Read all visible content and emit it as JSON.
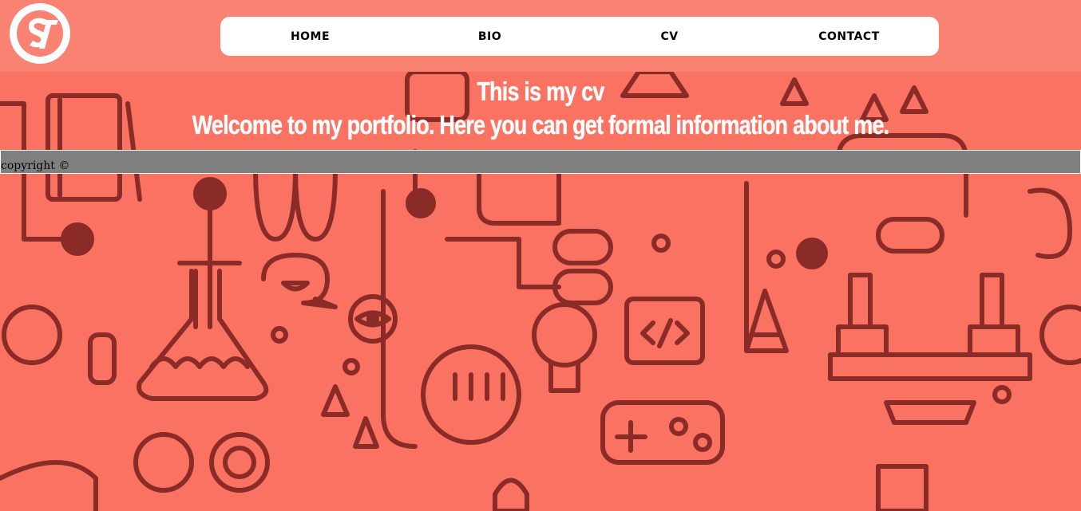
{
  "logo": {
    "text": "ST"
  },
  "nav": {
    "items": [
      "HOME",
      "BIO",
      "CV",
      "CONTACT"
    ]
  },
  "hero": {
    "title": "This is my cv",
    "subtitle": "Welcome to my portfolio. Here you can get formal information about me."
  },
  "footer": {
    "copyright": "copyright ©"
  },
  "colors": {
    "background": "#fa7262",
    "header": "#fa8272",
    "nav_bg": "#ffffff",
    "doodle": "#8b2b27",
    "footer_bg": "#808080"
  }
}
